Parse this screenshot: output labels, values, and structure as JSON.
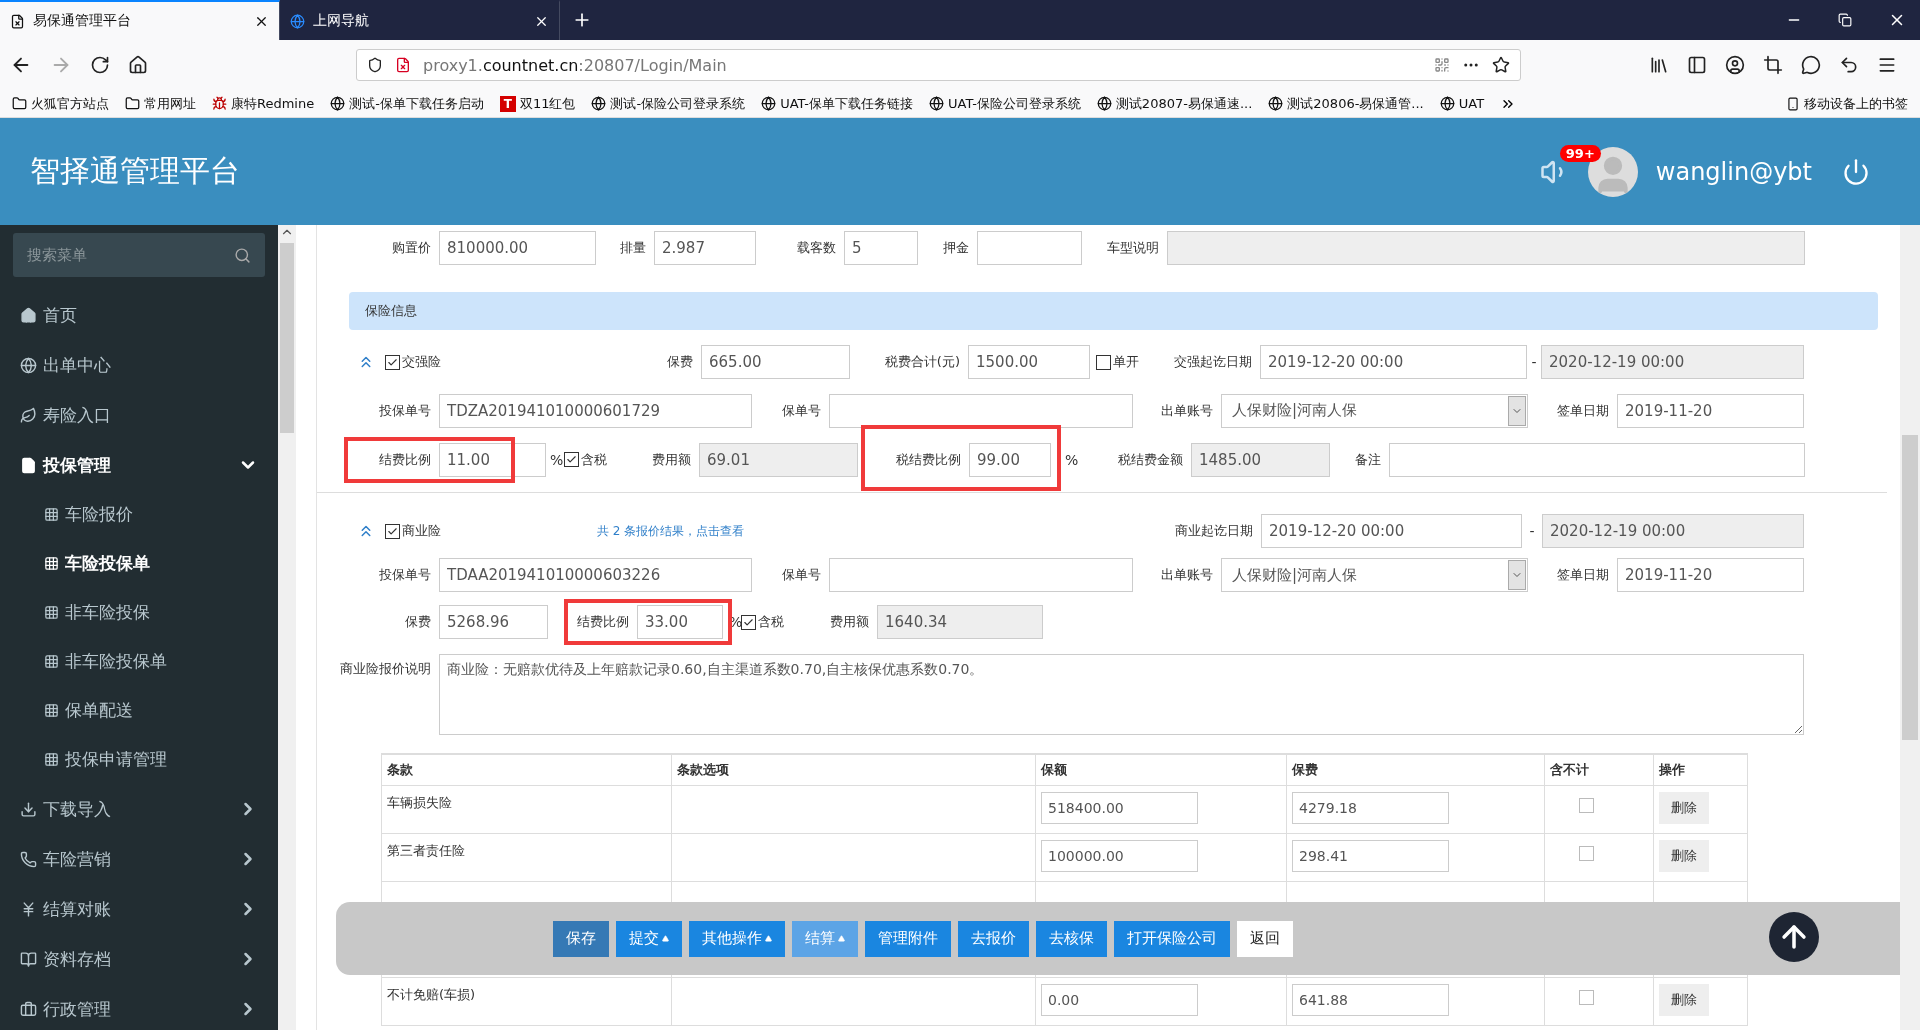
{
  "browser": {
    "tabs": [
      {
        "title": "易保通管理平台",
        "selected": true
      },
      {
        "title": "上网导航",
        "selected": false
      }
    ],
    "url": "proxy1.**countnet.cn**:20807/Login/Main",
    "bookmarks": [
      {
        "label": "火狐官方站点",
        "kind": "folder"
      },
      {
        "label": "常用网址",
        "kind": "folder"
      },
      {
        "label": "康特Redmine",
        "kind": "app"
      },
      {
        "label": "测试-保单下载任务启动",
        "kind": "globe"
      },
      {
        "label": "双11红包",
        "kind": "letter",
        "badge": "T"
      },
      {
        "label": "测试-保险公司登录系统",
        "kind": "globe"
      },
      {
        "label": "UAT-保单下载任务链接",
        "kind": "globe"
      },
      {
        "label": "UAT-保险公司登录系统",
        "kind": "globe"
      },
      {
        "label": "测试20807-易保通速...",
        "kind": "globe"
      },
      {
        "label": "测试20806-易保通管...",
        "kind": "globe"
      },
      {
        "label": "UAT",
        "kind": "globe"
      }
    ],
    "mobile_bookmarks": "移动设备上的书签"
  },
  "header": {
    "title": "智择通管理平台",
    "notifications": "99+",
    "user": "wanglin@ybt"
  },
  "sidebar": {
    "search_placeholder": "搜索菜单",
    "items": [
      {
        "label": "首页"
      },
      {
        "label": "出单中心"
      },
      {
        "label": "寿险入口"
      },
      {
        "label": "投保管理",
        "expanded": true,
        "children": [
          {
            "label": "车险报价",
            "selected": false
          },
          {
            "label": "车险投保单",
            "selected": true
          },
          {
            "label": "非车险投保",
            "selected": false
          },
          {
            "label": "非车险投保单",
            "selected": false
          },
          {
            "label": "保单配送",
            "selected": false
          },
          {
            "label": "投保申请管理",
            "selected": false
          }
        ]
      },
      {
        "label": "下载导入",
        "expanded": false
      },
      {
        "label": "车险营销",
        "expanded": false
      },
      {
        "label": "结算对账",
        "expanded": false
      },
      {
        "label": "资料存档",
        "expanded": false
      },
      {
        "label": "行政管理",
        "expanded": false
      }
    ]
  },
  "vehicle": [
    {
      "label": "购置价",
      "value": "810000.00",
      "disabled": false
    },
    {
      "label": "排量",
      "value": "2.987",
      "disabled": false
    },
    {
      "label": "载客数",
      "value": "5",
      "disabled": false
    },
    {
      "label": "押金",
      "disabled": false
    },
    {
      "label": "车型说明",
      "disabled": true
    }
  ],
  "section_title": "保险信息",
  "compulsory": {
    "expanded": true,
    "checked": true,
    "label": "交强险",
    "premium": {
      "label": "保费",
      "value": "665.00",
      "disabled": false
    },
    "tax_total": {
      "label": "税费合计(元)",
      "value": "1500.00",
      "disabled": false
    },
    "standalone": {
      "label": "单开",
      "checked": false
    },
    "period": {
      "label": "交强起讫日期",
      "start": "2019-12-20 00:00",
      "separator": "-",
      "end": "2020-12-19 00:00",
      "end_disabled": true
    },
    "application_no": {
      "label": "投保单号",
      "value": "TDZA201941010000601729",
      "disabled": false
    },
    "policy_no": {
      "label": "保单号",
      "disabled": false
    },
    "account": {
      "label": "出单账号",
      "value": "人保财险|河南人保"
    },
    "sign_date": {
      "label": "签单日期",
      "value": "2019-11-20",
      "disabled": false
    },
    "fee_rate": {
      "label": "结费比例",
      "value": "11.00",
      "unit": "%",
      "highlighted": true,
      "disabled": false
    },
    "tax_included": {
      "label": "含税",
      "checked": true
    },
    "fee_amount": {
      "label": "费用额",
      "value": "69.01",
      "disabled": true
    },
    "tax_fee_rate": {
      "label": "税结费比例",
      "value": "99.00",
      "unit": "%",
      "highlighted": true,
      "disabled": false
    },
    "tax_fee_amount": {
      "label": "税结费金额",
      "value": "1485.00",
      "disabled": true
    },
    "remark": {
      "label": "备注",
      "disabled": false
    }
  },
  "commercial": {
    "expanded": true,
    "checked": true,
    "label": "商业险",
    "quote_link": "共 2 条报价结果，点击查看",
    "period": {
      "label": "商业起讫日期",
      "start": "2019-12-20 00:00",
      "separator": "-",
      "end": "2020-12-19 00:00",
      "end_disabled": true
    },
    "application_no": {
      "label": "投保单号",
      "value": "TDAA201941010000603226",
      "disabled": false
    },
    "policy_no": {
      "label": "保单号",
      "disabled": false
    },
    "account": {
      "label": "出单账号",
      "value": "人保财险|河南人保"
    },
    "sign_date": {
      "label": "签单日期",
      "value": "2019-11-20",
      "disabled": false
    },
    "premium": {
      "label": "保费",
      "value": "5268.96",
      "disabled": false
    },
    "fee_rate": {
      "label": "结费比例",
      "value": "33.00",
      "unit": "%",
      "highlighted": true,
      "disabled": false
    },
    "tax_included": {
      "label": "含税",
      "checked": true
    },
    "fee_amount": {
      "label": "费用额",
      "value": "1640.34",
      "disabled": true
    },
    "note": {
      "label": "商业险报价说明",
      "value": "商业险：无赔款优待及上年赔款记录0.60,自主渠道系数0.70,自主核保优惠系数0.70。"
    }
  },
  "clauses": {
    "columns": [
      "条款",
      "条款选项",
      "保额",
      "保费",
      "含不计",
      "操作"
    ],
    "rows": [
      {
        "clause": "车辆损失险",
        "amount": "518400.00",
        "premium": "4279.18",
        "excluded": false,
        "action": "删除"
      },
      {
        "clause": "第三者责任险",
        "amount": "100000.00",
        "premium": "298.41",
        "excluded": false,
        "action": "删除"
      },
      {
        "clause": "不计免赔(车损)",
        "amount": "0.00",
        "premium": "641.88",
        "excluded": false,
        "action": "删除"
      }
    ]
  },
  "actions": [
    {
      "label": "保存",
      "kind": "dark",
      "dropdown": false
    },
    {
      "label": "提交",
      "kind": "normal",
      "dropdown": true
    },
    {
      "label": "其他操作",
      "kind": "normal",
      "dropdown": true
    },
    {
      "label": "结算",
      "kind": "light",
      "dropdown": true
    },
    {
      "label": "管理附件",
      "kind": "normal",
      "dropdown": false
    },
    {
      "label": "去报价",
      "kind": "normal",
      "dropdown": false
    },
    {
      "label": "去核保",
      "kind": "normal",
      "dropdown": false
    },
    {
      "label": "打开保险公司",
      "kind": "normal",
      "dropdown": false
    },
    {
      "label": "返回",
      "kind": "outline",
      "dropdown": false
    }
  ]
}
